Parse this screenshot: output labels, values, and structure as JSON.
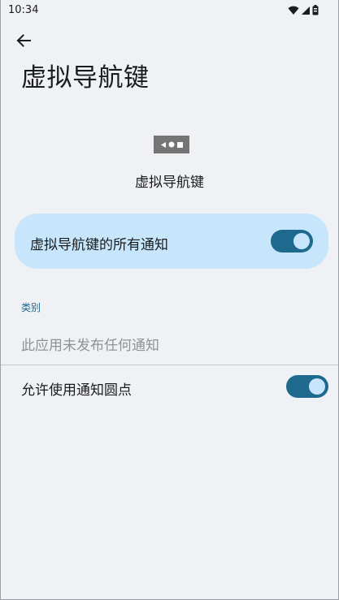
{
  "status_bar": {
    "time": "10:34",
    "icons": [
      "wifi-icon",
      "cell-signal-icon",
      "battery-icon"
    ]
  },
  "header": {
    "back_icon": "arrow-back-icon",
    "title": "虚拟导航键"
  },
  "app": {
    "icon": "navigation-bar-icon",
    "name": "虚拟导航键"
  },
  "all_notifications": {
    "label": "虚拟导航键的所有通知",
    "enabled": true
  },
  "category": {
    "header": "类别",
    "empty_text": "此应用未发布任何通知"
  },
  "notification_dot": {
    "label": "允许使用通知圆点",
    "enabled": true
  },
  "colors": {
    "background": "#eff1f4",
    "card": "#c7e6fb",
    "accent": "#1e6a8e",
    "text": "#1b1c1e",
    "secondary_text": "#8f9297"
  }
}
